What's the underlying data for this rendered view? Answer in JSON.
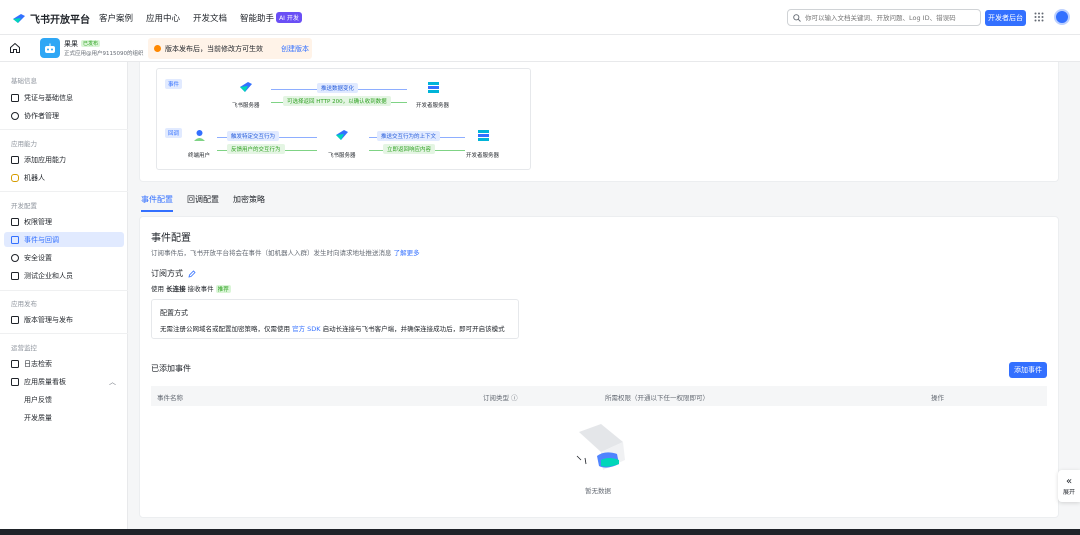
{
  "brand": {
    "name": "飞书开放平台",
    "accent": "#3370ff"
  },
  "topnav": {
    "items": [
      "客户案例",
      "应用中心",
      "开发文档",
      "智能助手"
    ],
    "ai_badge": "AI 开发"
  },
  "search": {
    "placeholder": "你可以输入文档关键词、开放问题、Log ID、错误码"
  },
  "dev_console_label": "开发者后台",
  "app": {
    "name": "果果",
    "status": "已发布",
    "subtitle": "正式应用@用户9115090的组织"
  },
  "notice": {
    "text": "版本发布后，当前修改方可生效",
    "link": "创建版本"
  },
  "sidebar": {
    "sections": [
      {
        "title": "基础信息",
        "items": [
          "凭证与基础信息",
          "协作者管理"
        ]
      },
      {
        "title": "应用能力",
        "items": [
          "添加应用能力",
          "机器人"
        ]
      },
      {
        "title": "开发配置",
        "items": [
          "权限管理",
          "事件与回调",
          "安全设置",
          "测试企业和人员"
        ]
      },
      {
        "title": "应用发布",
        "items": [
          "版本管理与发布"
        ]
      },
      {
        "title": "运营监控",
        "items": [
          "日志检索",
          "应用质量看板",
          "用户反馈",
          "开发质量"
        ]
      }
    ],
    "active": "事件与回调"
  },
  "diagram": {
    "event_label": "事件",
    "callback_label": "回调",
    "feishu_server": "飞书服务器",
    "dev_server": "开发者服务器",
    "end_user": "终端用户",
    "push_change": "推送数据变化",
    "return_ok": "可选择返回 HTTP 200，以确认收到数据",
    "trigger": "触发特定交互行为",
    "feedback": "反馈用户的交互行为",
    "push_context": "推送交互行为的上下文",
    "immediate_return": "立即返回响应内容"
  },
  "tabs": [
    "事件配置",
    "回调配置",
    "加密策略"
  ],
  "event_config": {
    "title": "事件配置",
    "desc": "订阅事件后，飞书开放平台将会在事件（如机器人入群）发生时向请求地址推送消息",
    "desc_link": "了解更多",
    "sub_title": "订阅方式",
    "use_prefix": "使用",
    "use_mode": "长连接",
    "use_suffix": "接收事件",
    "recommend": "推荐",
    "config_title": "配置方式",
    "config_desc_prefix": "无需注册公网域名或配置加密策略，仅需使用",
    "config_desc_link": "官方 SDK",
    "config_desc_suffix": "启动长连接与飞书客户端，并确保连接成功后，即可开启该模式"
  },
  "added_events": {
    "title": "已添加事件",
    "add_button": "添加事件",
    "columns": [
      "事件名称",
      "订阅类型",
      "所需权限（开通以下任一权限即可）",
      "操作"
    ],
    "empty_text": "暂无数据"
  },
  "side_toggle": {
    "label": "展开"
  }
}
